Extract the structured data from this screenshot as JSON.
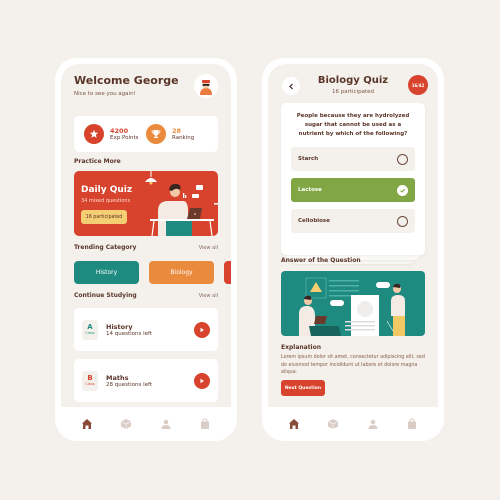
{
  "home": {
    "greeting": "Welcome George",
    "subtitle": "Nice to see you again!",
    "avatar_icon": "user-avatar",
    "stats": [
      {
        "value": "4200",
        "label": "Exp Points",
        "icon": "star-icon",
        "color": "#d8432d"
      },
      {
        "value": "28",
        "label": "Ranking",
        "icon": "trophy-icon",
        "color": "#ea8a3d"
      }
    ],
    "practice_title": "Practice More",
    "daily_quiz": {
      "title": "Daily Quiz",
      "subtitle": "34 mixed questions",
      "badge": "16 participated"
    },
    "trending_title": "Trending Category",
    "trending_view_all": "View all",
    "categories": [
      {
        "label": "History",
        "color": "#1f8a80"
      },
      {
        "label": "Biology",
        "color": "#ea8a3d"
      },
      {
        "label": "",
        "color": "#d8432d"
      }
    ],
    "continue_title": "Continue Studying",
    "continue_view_all": "View all",
    "courses": [
      {
        "letter": "A",
        "class_label": "Class",
        "name": "History",
        "progress": "14 questions left",
        "color": "#1f8a80"
      },
      {
        "letter": "B",
        "class_label": "Class",
        "name": "Maths",
        "progress": "28 questions left",
        "color": "#d8432d"
      }
    ]
  },
  "quiz": {
    "title": "Biology Quiz",
    "participants": "16 participated",
    "progress_badge": "16/42",
    "question": "People because they are hydrolyzed sugar that cannot be used as a nutrient by which of the following?",
    "options": [
      {
        "label": "Starch",
        "selected": false
      },
      {
        "label": "Lactose",
        "selected": true
      },
      {
        "label": "Cellobiose",
        "selected": false
      }
    ],
    "answer_title": "Answer of the Question",
    "explanation_title": "Explanation",
    "explanation_body": "Lorem ipsum dolor sit amet, consectetur adipiscing elit, sed do eiusmod tempor incididunt ut labore et dolore magna aliqua.",
    "next_button": "Next Question"
  },
  "nav": {
    "items": [
      "home-icon",
      "box-icon",
      "profile-icon",
      "bag-icon"
    ],
    "active": "home-icon",
    "active_color": "#8a4a3a",
    "inactive_color": "#d9cdc6"
  },
  "colors": {
    "background": "#f4f1ed",
    "primary_red": "#d8432d",
    "teal": "#1f8a80",
    "orange": "#ea8a3d",
    "green": "#80a744",
    "yellow": "#f5cd73",
    "brown_text": "#5a3527"
  }
}
